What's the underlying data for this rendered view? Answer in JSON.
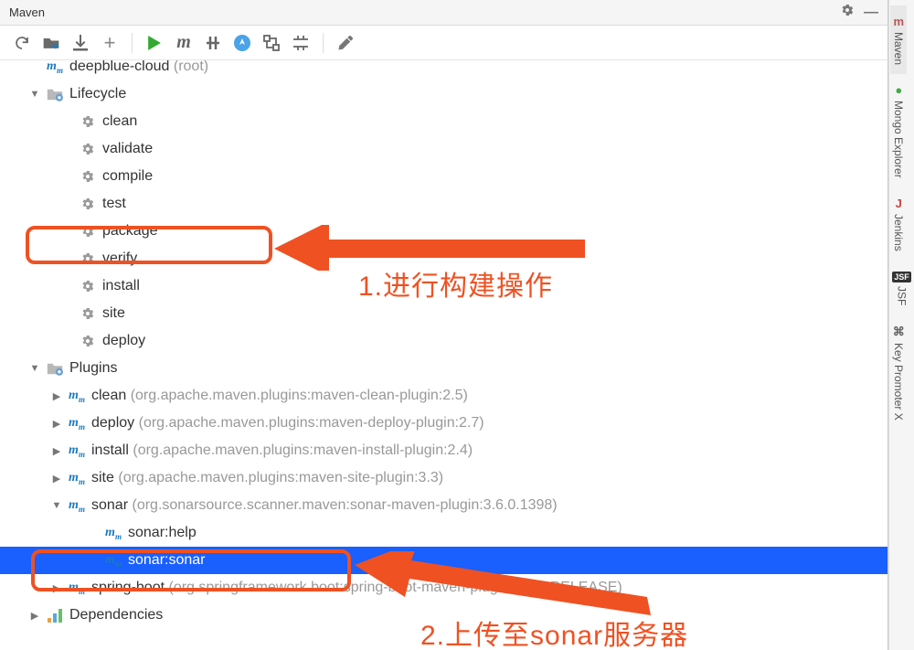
{
  "title": "Maven",
  "right_tabs": [
    {
      "icon": "m",
      "label": "Maven",
      "color": "#b55"
    },
    {
      "icon": "●",
      "label": "Mongo Explorer",
      "color": "#4a4"
    },
    {
      "icon": "J",
      "label": "Jenkins",
      "color": "#c44"
    },
    {
      "icon": "JSF",
      "label": "JSF",
      "color": "#222"
    },
    {
      "icon": "⌘",
      "label": "Key Promoter X",
      "color": "#666"
    }
  ],
  "toolbar": {
    "refresh": "↻",
    "generate": "📁",
    "download": "⬇",
    "add": "+",
    "run": "▶",
    "m": "m",
    "skip": "⫽",
    "offline": "⚡",
    "deps": "⇵",
    "collapse": "⇲",
    "wrench": "🔧"
  },
  "tree": {
    "root": {
      "label": "deepblue-cloud",
      "suffix": "(root)"
    },
    "lifecycle_label": "Lifecycle",
    "lifecycle": [
      "clean",
      "validate",
      "compile",
      "test",
      "package",
      "verify",
      "install",
      "site",
      "deploy"
    ],
    "plugins_label": "Plugins",
    "plugins": [
      {
        "name": "clean",
        "desc": "(org.apache.maven.plugins:maven-clean-plugin:2.5)"
      },
      {
        "name": "deploy",
        "desc": "(org.apache.maven.plugins:maven-deploy-plugin:2.7)"
      },
      {
        "name": "install",
        "desc": "(org.apache.maven.plugins:maven-install-plugin:2.4)"
      },
      {
        "name": "site",
        "desc": "(org.apache.maven.plugins:maven-site-plugin:3.3)"
      },
      {
        "name": "sonar",
        "desc": "(org.sonarsource.scanner.maven:sonar-maven-plugin:3.6.0.1398)",
        "expanded": true,
        "goals": [
          "sonar:help",
          "sonar:sonar"
        ]
      },
      {
        "name": "spring-boot",
        "desc": "(org.springframework.boot:spring-boot-maven-plugin:2.1.7.RELEASE)"
      }
    ],
    "deps_label": "Dependencies"
  },
  "annotations": {
    "a1": "1.进行构建操作",
    "a2": "2.上传至sonar服务器"
  }
}
